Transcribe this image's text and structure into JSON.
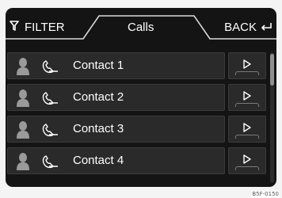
{
  "header": {
    "filter_label": "FILTER",
    "title": "Calls",
    "back_label": "BACK"
  },
  "contacts": [
    {
      "name": "Contact 1"
    },
    {
      "name": "Contact 2"
    },
    {
      "name": "Contact 3"
    },
    {
      "name": "Contact 4"
    }
  ],
  "image_code": "B5F-0150",
  "icons": {
    "filter": "filter-icon",
    "back": "back-arrow-icon",
    "contact": "person-icon",
    "call": "call-icon",
    "play": "play-icon"
  },
  "colors": {
    "screen_bg": "#141414",
    "row_bg": "#2a2a2a",
    "tab_line": "#d9d9d9",
    "text": "#ffffff",
    "icon_gray": "#9a9a9a"
  }
}
